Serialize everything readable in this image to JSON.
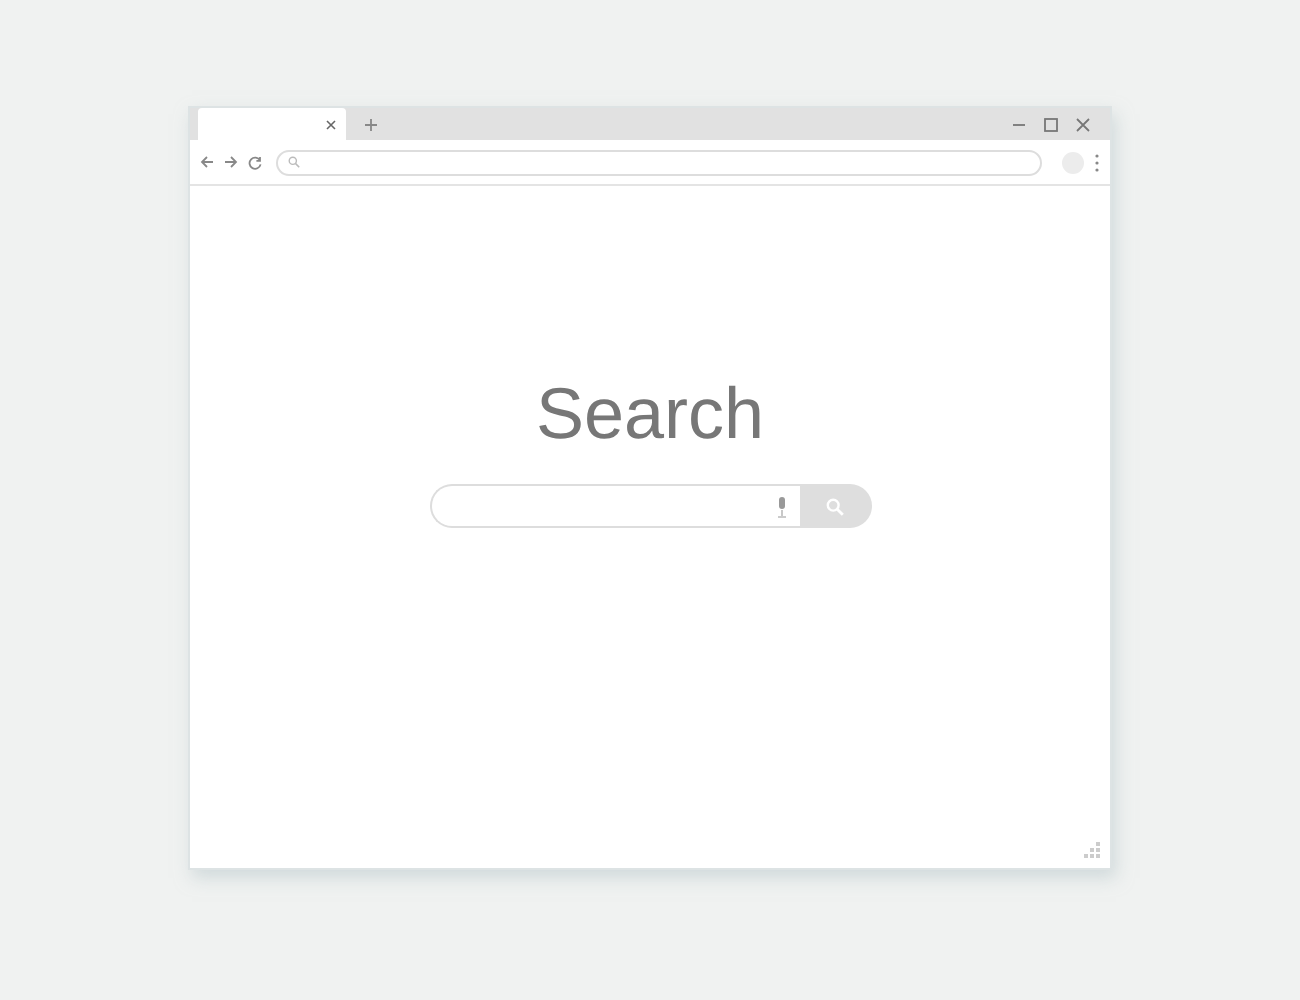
{
  "page": {
    "heading": "Search"
  }
}
